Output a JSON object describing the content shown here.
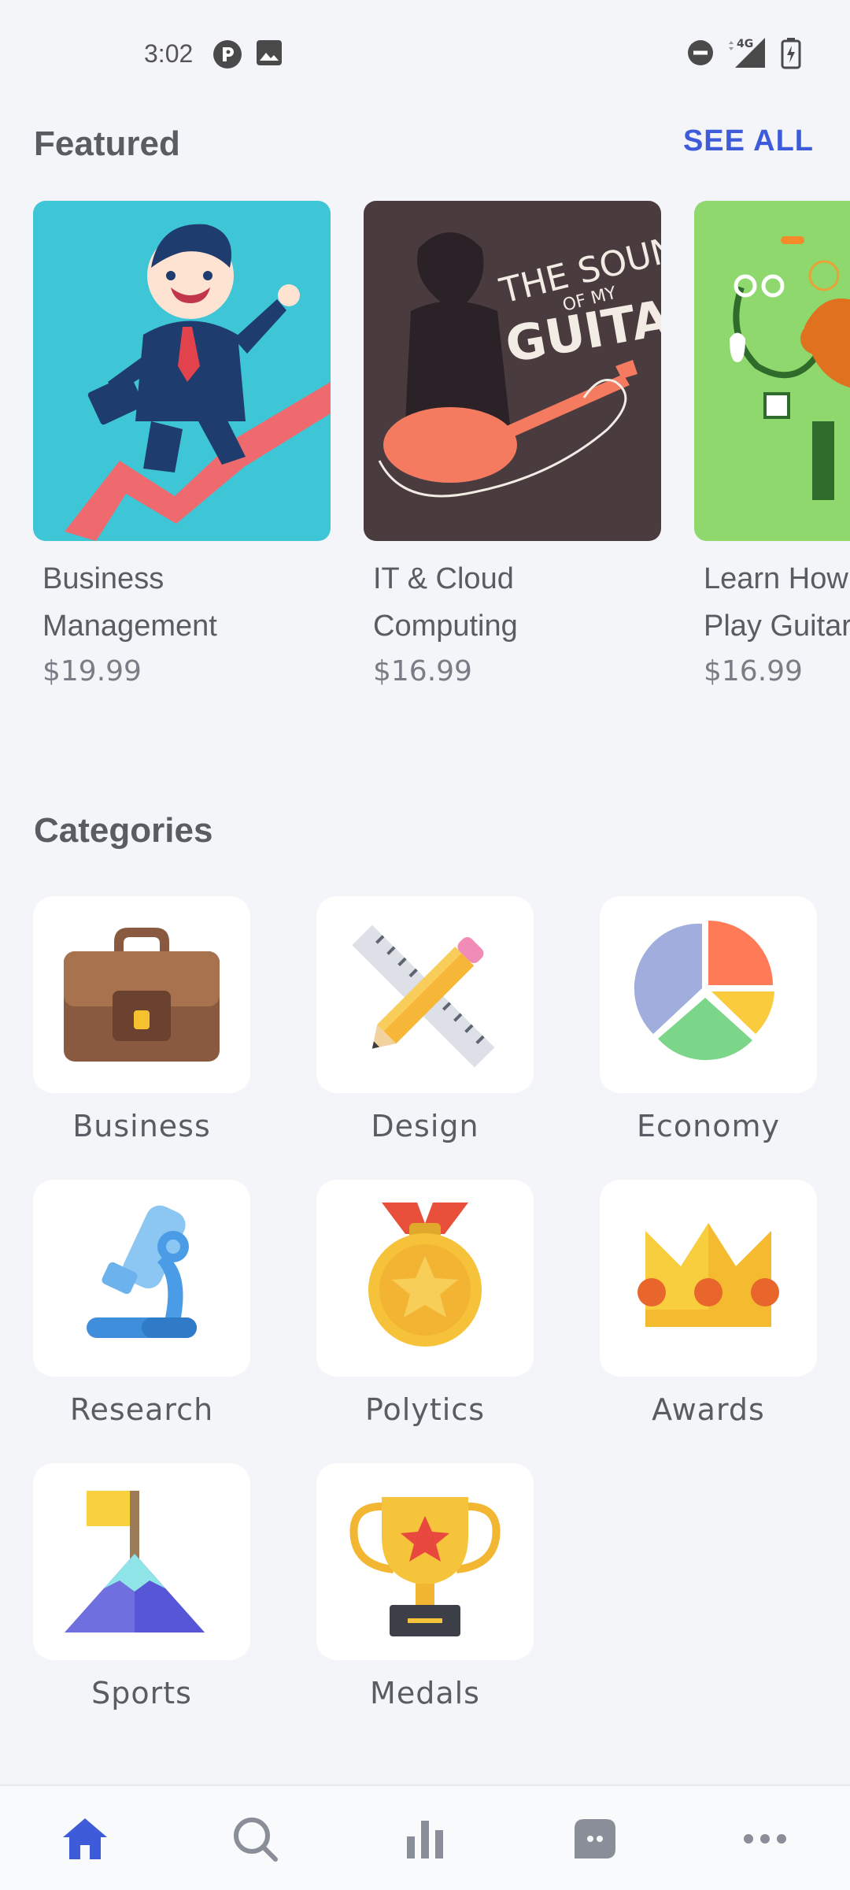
{
  "status_bar": {
    "time": "3:02",
    "network": "4G",
    "icons": [
      "data-saver-icon",
      "image-icon",
      "dnd-icon",
      "signal-icon",
      "battery-charging-icon"
    ]
  },
  "featured": {
    "title": "Featured",
    "see_all": "SEE ALL",
    "courses": [
      {
        "title_line1": "Business",
        "title_line2": "Management",
        "price": "$19.99",
        "thumb_color": "#3EC6D6"
      },
      {
        "title_line1": "IT & Cloud",
        "title_line2": "Computing",
        "price": "$16.99",
        "thumb_color": "#4A3B3F",
        "art_text_1": "THE SOUND",
        "art_text_2": "OF MY",
        "art_text_3": "GUITAR"
      },
      {
        "title_line1": "Learn How to",
        "title_line2": "Play Guitar",
        "price": "$16.99",
        "thumb_color": "#8ED86E"
      }
    ]
  },
  "categories": {
    "title": "Categories",
    "items": [
      {
        "label": "Business",
        "icon": "briefcase-icon"
      },
      {
        "label": "Design",
        "icon": "ruler-pencil-icon"
      },
      {
        "label": "Economy",
        "icon": "pie-chart-icon"
      },
      {
        "label": "Research",
        "icon": "microscope-icon"
      },
      {
        "label": "Polytics",
        "icon": "medal-icon"
      },
      {
        "label": "Awards",
        "icon": "crown-icon"
      },
      {
        "label": "Sports",
        "icon": "mountain-flag-icon"
      },
      {
        "label": "Medals",
        "icon": "trophy-icon"
      }
    ]
  },
  "bottom_nav": {
    "items": [
      {
        "icon": "home-icon",
        "active": true
      },
      {
        "icon": "search-icon",
        "active": false
      },
      {
        "icon": "bar-chart-icon",
        "active": false
      },
      {
        "icon": "chat-icon",
        "active": false
      },
      {
        "icon": "more-icon",
        "active": false
      }
    ],
    "active_color": "#3E5BDA",
    "inactive_color": "#8A8E98"
  }
}
